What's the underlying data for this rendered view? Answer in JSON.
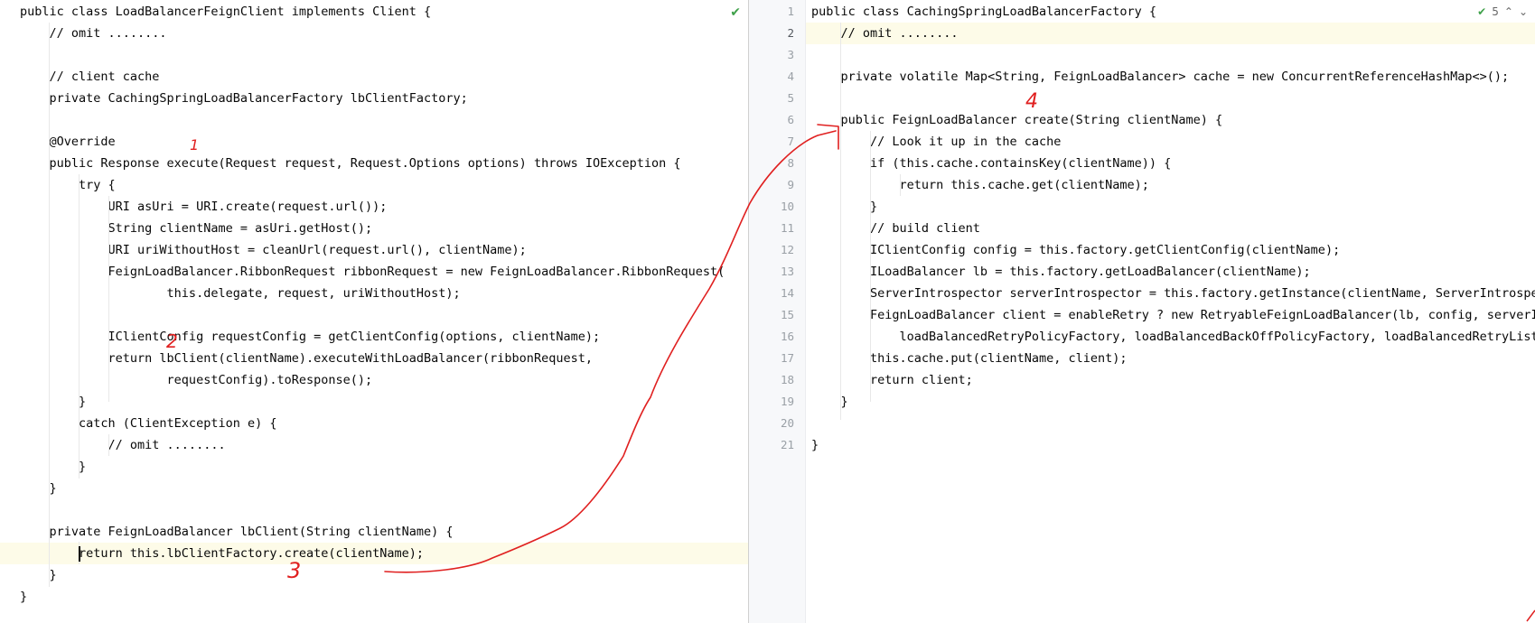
{
  "left_editor": {
    "lines": [
      "public class LoadBalancerFeignClient implements Client {",
      "    // omit ........",
      "",
      "    // client cache",
      "    private CachingSpringLoadBalancerFactory lbClientFactory;",
      "",
      "    @Override",
      "    public Response execute(Request request, Request.Options options) throws IOException {",
      "        try {",
      "            URI asUri = URI.create(request.url());",
      "            String clientName = asUri.getHost();",
      "            URI uriWithoutHost = cleanUrl(request.url(), clientName);",
      "            FeignLoadBalancer.RibbonRequest ribbonRequest = new FeignLoadBalancer.RibbonRequest(",
      "                    this.delegate, request, uriWithoutHost);",
      "",
      "            IClientConfig requestConfig = getClientConfig(options, clientName);",
      "            return lbClient(clientName).executeWithLoadBalancer(ribbonRequest,",
      "                    requestConfig).toResponse();",
      "        }",
      "        catch (ClientException e) {",
      "            // omit ........",
      "        }",
      "    }",
      "",
      "    private FeignLoadBalancer lbClient(String clientName) {",
      "        return this.lbClientFactory.create(clientName);",
      "    }",
      "}"
    ],
    "highlight_line": 26,
    "status_icon": "check-icon"
  },
  "right_editor": {
    "line_numbers": [
      "1",
      "2",
      "3",
      "4",
      "5",
      "6",
      "7",
      "8",
      "9",
      "10",
      "11",
      "12",
      "13",
      "14",
      "15",
      "16",
      "17",
      "18",
      "19",
      "20",
      "21"
    ],
    "lines": [
      "public class CachingSpringLoadBalancerFactory {",
      "    // omit ........",
      "",
      "    private volatile Map<String, FeignLoadBalancer> cache = new ConcurrentReferenceHashMap<>();",
      "",
      "    public FeignLoadBalancer create(String clientName) {",
      "        // Look it up in the cache",
      "        if (this.cache.containsKey(clientName)) {",
      "            return this.cache.get(clientName);",
      "        }",
      "        // build client",
      "        IClientConfig config = this.factory.getClientConfig(clientName);",
      "        ILoadBalancer lb = this.factory.getLoadBalancer(clientName);",
      "        ServerIntrospector serverIntrospector = this.factory.getInstance(clientName, ServerIntrospector.class);",
      "        FeignLoadBalancer client = enableRetry ? new RetryableFeignLoadBalancer(lb, config, serverIntrospector,",
      "            loadBalancedRetryPolicyFactory, loadBalancedBackOffPolicyFactory, loadBalancedRetryListenerFactory)",
      "        this.cache.put(clientName, client);",
      "        return client;",
      "    }",
      "",
      "}"
    ],
    "highlight_line": 2,
    "inspection_count": "5",
    "status_icon": "check-icon"
  },
  "annotations": {
    "marks": [
      "1",
      "2",
      "3",
      "4"
    ],
    "color": "#e02020"
  }
}
